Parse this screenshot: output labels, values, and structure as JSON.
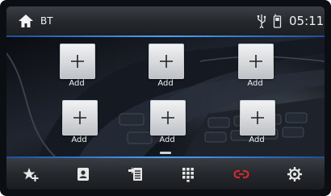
{
  "header": {
    "title": "BT",
    "clock": "05:11",
    "icons": [
      "home-icon",
      "usb-icon",
      "phone-icon"
    ]
  },
  "tiles": [
    {
      "label": "Add",
      "icon": "plus-icon"
    },
    {
      "label": "Add",
      "icon": "plus-icon"
    },
    {
      "label": "Add",
      "icon": "plus-icon"
    },
    {
      "label": "Add",
      "icon": "plus-icon"
    },
    {
      "label": "Add",
      "icon": "plus-icon"
    },
    {
      "label": "Add",
      "icon": "plus-icon"
    }
  ],
  "bottom_nav": [
    {
      "name": "favorites-add",
      "icon": "star-plus-icon"
    },
    {
      "name": "contacts",
      "icon": "contact-card-icon"
    },
    {
      "name": "call-log",
      "icon": "call-log-icon"
    },
    {
      "name": "dialpad",
      "icon": "dialpad-icon"
    },
    {
      "name": "link",
      "icon": "link-icon"
    },
    {
      "name": "settings",
      "icon": "gear-icon"
    }
  ],
  "colors": {
    "accent_blue": "#3b8fe8",
    "link_red": "#d42a2a",
    "bar_dark": "#25282c"
  }
}
